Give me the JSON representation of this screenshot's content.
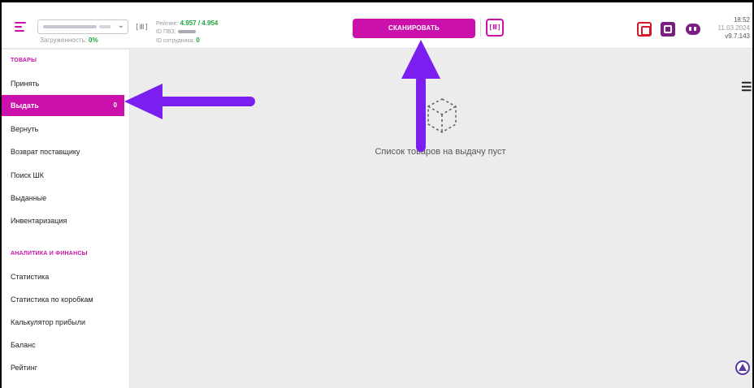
{
  "header": {
    "load_label": "Загруженность:",
    "load_value": "0%",
    "rating_label": "Рейтинг:",
    "rating_value": "4.957 / 4.954",
    "pvz_label": "ID ПВЗ:",
    "employee_label": "ID сотрудника:",
    "employee_value": "0",
    "scan_label": "СКАНИРОВАТЬ",
    "time": "18:52",
    "date": "11.03.2024",
    "version": "v9.7.143"
  },
  "sidebar": {
    "section_goods": "ТОВАРЫ",
    "goods_items": [
      {
        "label": "Принять"
      },
      {
        "label": "Выдать",
        "count": "0"
      },
      {
        "label": "Вернуть"
      },
      {
        "label": "Возврат поставщику"
      },
      {
        "label": "Поиск ШК"
      },
      {
        "label": "Выданные"
      },
      {
        "label": "Инвентаризация"
      }
    ],
    "section_finance": "АНАЛИТИКА И ФИНАНСЫ",
    "finance_items": [
      {
        "label": "Статистика"
      },
      {
        "label": "Статистика по коробкам"
      },
      {
        "label": "Калькулятор прибыли"
      },
      {
        "label": "Баланс"
      },
      {
        "label": "Рейтинг"
      }
    ]
  },
  "main": {
    "empty_text": "Список товаров на выдачу пуст"
  },
  "icons": {
    "menu": "hamburger-icon",
    "dropdown": "chevron-down-icon",
    "barcode": "barcode-scan-icon",
    "survey": "survey-icon",
    "wallet": "wallet-icon",
    "support": "chat-bot-icon",
    "empty": "box-icon",
    "filter": "filter-icon",
    "help": "help-icon"
  },
  "colors": {
    "brand": "#cb11ab",
    "success": "#1aa43a",
    "annotation": "#7a1ff0"
  }
}
